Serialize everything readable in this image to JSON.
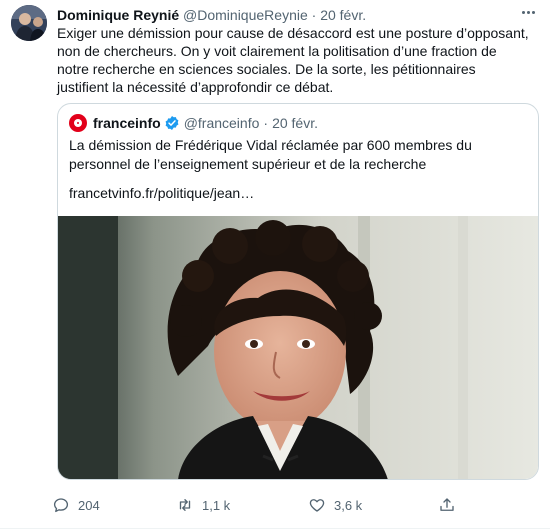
{
  "tweet": {
    "author_name": "Dominique Reynié",
    "author_handle": "@DominiqueReynie",
    "separator": "·",
    "date": "20 févr.",
    "text": "Exiger une démission pour cause de désaccord est une posture d’opposant, non de chercheurs. On y voit clairement la politisation d’une fraction de notre recherche en sciences sociales. De la sorte, les pétitionnaires justifient la nécessité d’approfondir ce débat."
  },
  "quoted": {
    "author_name": "franceinfo",
    "author_handle": "@franceinfo",
    "separator": "·",
    "date": "20 févr.",
    "verified": true,
    "text": "La démission de Frédérique Vidal réclamée par 600 membres du personnel de l’enseignement supérieur et de la recherche",
    "link": "francetvinfo.fr/politique/jean…"
  },
  "actions": {
    "reply_count": "204",
    "retweet_count": "1,1 k",
    "like_count": "3,6 k"
  },
  "icons": [
    "more-icon",
    "verified-icon",
    "reply-icon",
    "retweet-icon",
    "like-icon",
    "share-icon"
  ],
  "colors": {
    "text": "#0f1419",
    "secondary": "#536471",
    "verified": "#1d9bf0",
    "border": "#cfd9de",
    "franceinfo_red": "#e2001a"
  }
}
